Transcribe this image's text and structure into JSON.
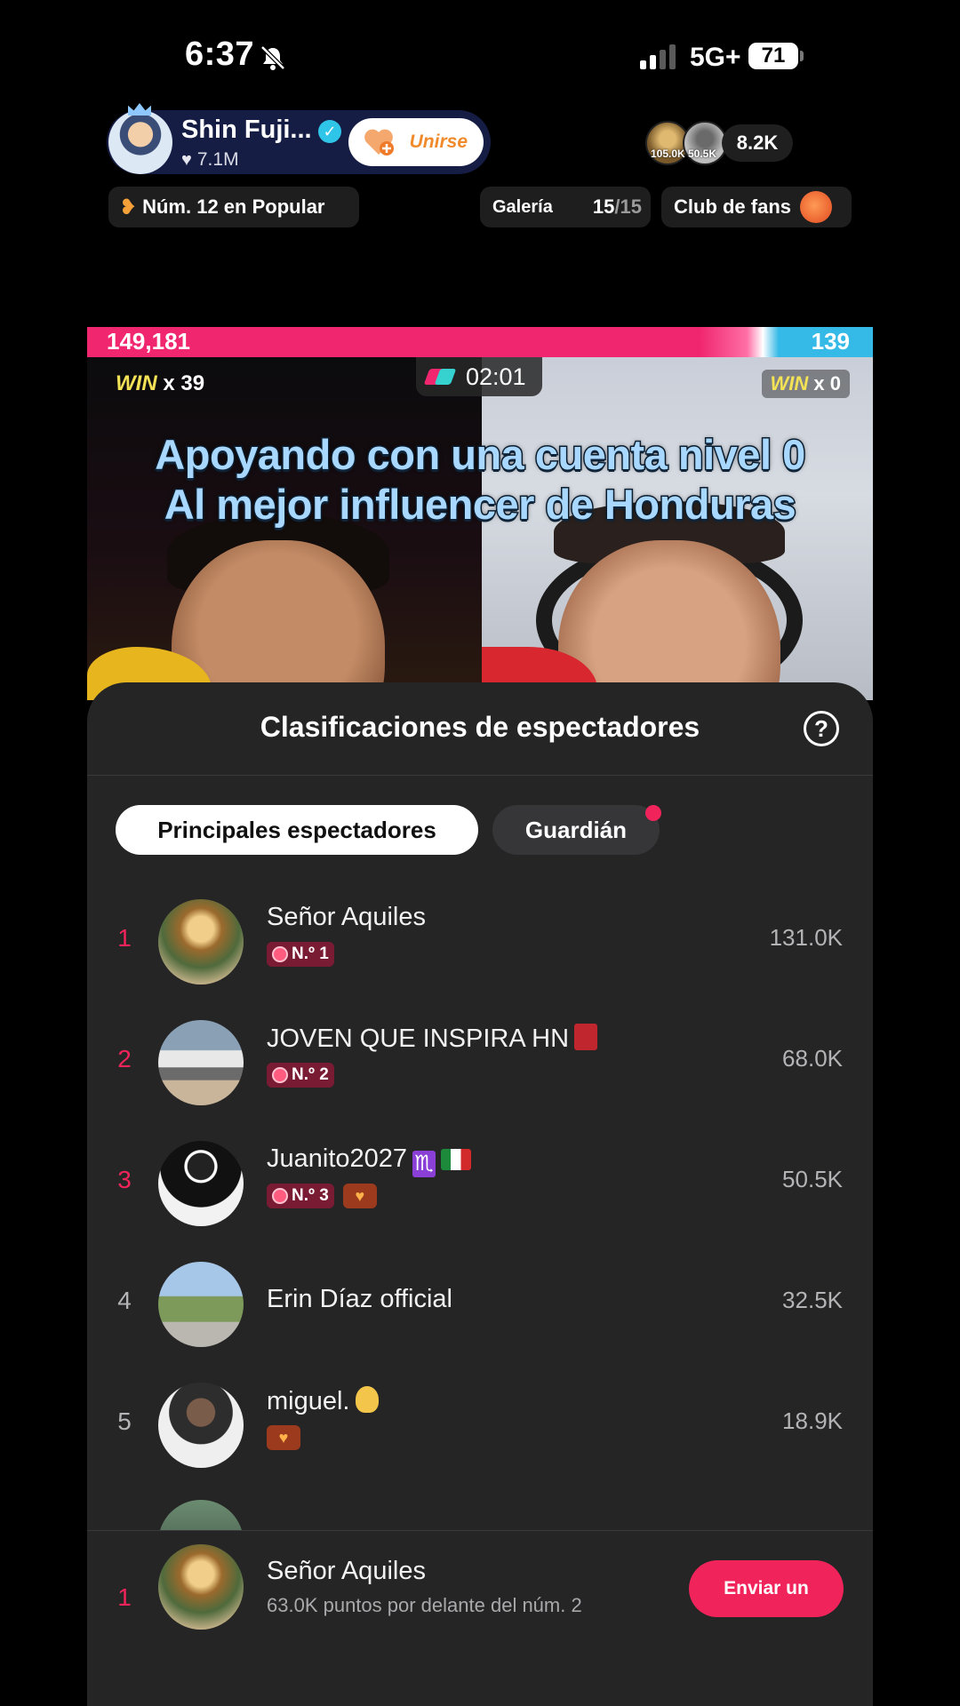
{
  "status_bar": {
    "time": "6:37",
    "network": "5G+",
    "battery": "71"
  },
  "host": {
    "name": "Shin Fuji...",
    "likes": "7.1M",
    "join_label": "Unirse"
  },
  "viewers": {
    "badge_1": "105.0K",
    "badge_2": "50.5K",
    "count": "8.2K"
  },
  "chips": {
    "rank": "Núm. 12 en Popular",
    "gallery_label": "Galería",
    "gallery_count": "15",
    "gallery_total": "/15",
    "fan_club": "Club de fans"
  },
  "battle": {
    "score_left": "149,181",
    "score_right": "139",
    "win_left_word": "WIN",
    "win_left_count": "x 39",
    "win_right_word": "WIN",
    "win_right_count": "x 0",
    "timer": "02:01",
    "caption_line1": "Apoyando con una cuenta nivel 0",
    "caption_line2": "Al mejor influencer de Honduras"
  },
  "panel": {
    "title": "Clasificaciones de espectadores",
    "tabs": [
      {
        "label": "Principales espectadores",
        "active": true
      },
      {
        "label": "Guardián",
        "active": false
      }
    ],
    "rows": [
      {
        "rank": "1",
        "name": "Señor Aquiles",
        "badge": "N.º 1",
        "points": "131.0K"
      },
      {
        "rank": "2",
        "name": "JOVEN QUE INSPIRA HN",
        "badge": "N.º 2",
        "points": "68.0K"
      },
      {
        "rank": "3",
        "name": "Juanito2027",
        "badge": "N.º 3",
        "points": "50.5K"
      },
      {
        "rank": "4",
        "name": "Erin Díaz official",
        "points": "32.5K"
      },
      {
        "rank": "5",
        "name": "miguel.",
        "points": "18.9K"
      }
    ],
    "footer": {
      "rank": "1",
      "name": "Señor Aquiles",
      "subtitle": "63.0K puntos por delante del núm. 2",
      "button": "Enviar un"
    }
  },
  "colors": {
    "accent_pink": "#f0245a",
    "team_blue": "#35b9e6",
    "panel_bg": "#252526"
  }
}
